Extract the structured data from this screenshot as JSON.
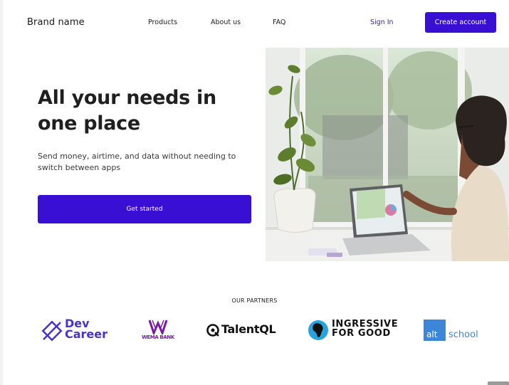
{
  "nav": {
    "brand": "Brand name",
    "links": [
      "Products",
      "About us",
      "FAQ"
    ],
    "sign_in": "Sign In",
    "create_account": "Create account"
  },
  "hero": {
    "title": "All your needs in one place",
    "subtitle": "Send money, airtime, and data  without needing to switch between apps",
    "cta": "Get started"
  },
  "partners": {
    "title": "OUR PARTNERS",
    "logos": [
      {
        "name": "devcareer-logo",
        "text": [
          "Dev",
          "Career"
        ]
      },
      {
        "name": "wema-bank-logo",
        "text": "WEMA BANK"
      },
      {
        "name": "talentql-logo",
        "text": "TalentQL"
      },
      {
        "name": "ingressive-for-good-logo",
        "text": [
          "INGRESSIVE",
          "FOR GOOD"
        ]
      },
      {
        "name": "altschool-logo",
        "text": [
          "alt",
          "school"
        ]
      }
    ]
  },
  "colors": {
    "primary": "#3a0fd4",
    "devcareer": "#4733c7",
    "wema": "#7a1aa3",
    "altschool": "#3b86d9"
  }
}
